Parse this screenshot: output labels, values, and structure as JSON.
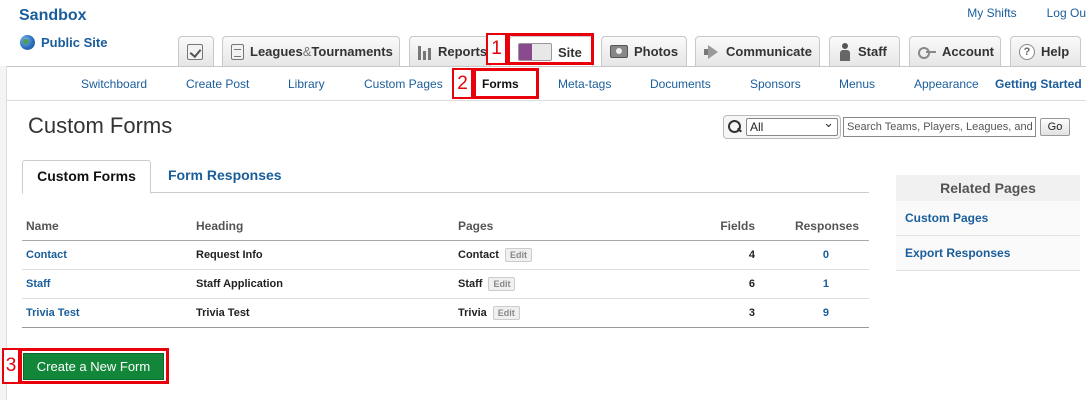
{
  "header": {
    "brand": "Sandbox",
    "public_site": "Public Site",
    "top_links": [
      "My Shifts",
      "Log Ou"
    ]
  },
  "main_tabs": [
    {
      "label": "",
      "icon": "checkbox-icon"
    },
    {
      "label": "Leagues",
      "amp": "&",
      "label2": "Tournaments",
      "icon": "document-icon"
    },
    {
      "label": "Reports",
      "icon": "bar-chart-icon"
    },
    {
      "label": "Site",
      "icon": "site-thumbnail-icon",
      "active": true
    },
    {
      "label": "Photos",
      "icon": "camera-icon"
    },
    {
      "label": "Communicate",
      "icon": "megaphone-icon"
    },
    {
      "label": "Staff",
      "icon": "staff-icon"
    },
    {
      "label": "Account",
      "icon": "key-icon"
    },
    {
      "label": "Help",
      "icon": "help-icon"
    }
  ],
  "subnav": [
    "Switchboard",
    "Create Post",
    "Library",
    "Custom Pages",
    "Forms",
    "Meta-tags",
    "Documents",
    "Sponsors",
    "Menus",
    "Appearance",
    "Getting Started"
  ],
  "annotations": {
    "m1": "1",
    "m2": "2",
    "m3": "3",
    "color": "#e8000b"
  },
  "page": {
    "title": "Custom Forms"
  },
  "search": {
    "scope": "All",
    "placeholder": "Search Teams, Players, Leagues, and",
    "go": "Go"
  },
  "content_tabs": [
    "Custom Forms",
    "Form Responses"
  ],
  "table": {
    "headers": [
      "Name",
      "Heading",
      "Pages",
      "Fields",
      "Responses"
    ],
    "edit_label": "Edit",
    "rows": [
      {
        "name": "Contact",
        "heading": "Request Info",
        "page": "Contact",
        "fields": "4",
        "responses": "0"
      },
      {
        "name": "Staff",
        "heading": "Staff Application",
        "page": "Staff",
        "fields": "6",
        "responses": "1"
      },
      {
        "name": "Trivia Test",
        "heading": "Trivia Test",
        "page": "Trivia",
        "fields": "3",
        "responses": "9"
      }
    ]
  },
  "create_button": "Create a New Form",
  "related": {
    "title": "Related Pages",
    "items": [
      "Custom Pages",
      "Export Responses"
    ]
  },
  "colors": {
    "link": "#1a5d9b",
    "create_button": "#12873a",
    "annotation": "#e8000b"
  }
}
